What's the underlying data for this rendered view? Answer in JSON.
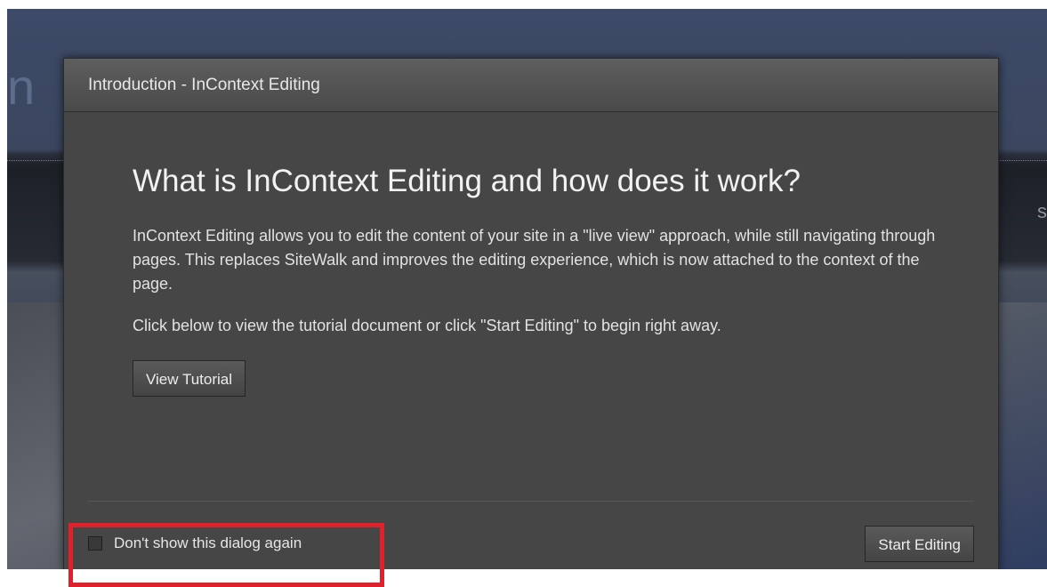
{
  "background": {
    "left_glyph": "n",
    "right_glyph": "s"
  },
  "dialog": {
    "title": "Introduction - InContext Editing",
    "heading": "What is InContext Editing and how does it work?",
    "paragraph1": "InContext Editing allows you to edit the content of your site in a \"live view\" approach, while still navigating through pages. This replaces SiteWalk and improves the editing experience, which is now attached to the context of the page.",
    "paragraph2": "Click below to view the tutorial document or click \"Start Editing\" to begin right away.",
    "view_tutorial_label": "View Tutorial",
    "dont_show_label": "Don't show this dialog again",
    "dont_show_checked": false,
    "start_editing_label": "Start Editing"
  },
  "annotation": {
    "highlight_color": "#e0202a"
  }
}
